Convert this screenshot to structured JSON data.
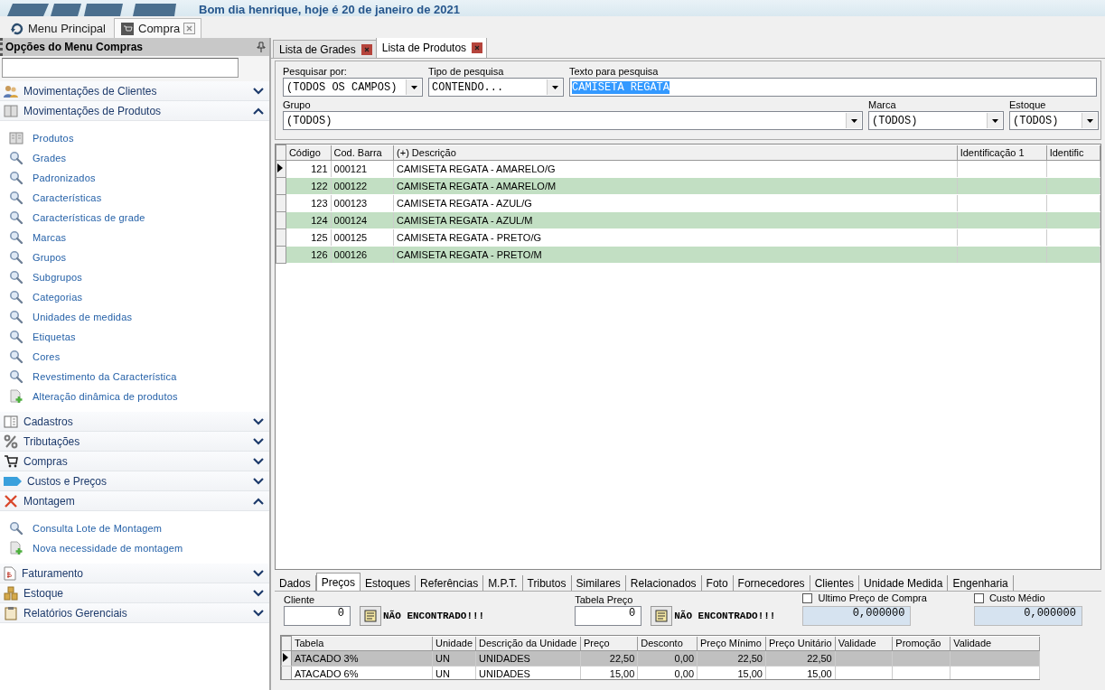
{
  "header": {
    "greeting": "Bom dia henrique, hoje é 20 de janeiro de 2021"
  },
  "main_tabs": [
    {
      "label": "Menu Principal",
      "selected": false,
      "closable": false
    },
    {
      "label": "Compra",
      "selected": true,
      "closable": true
    }
  ],
  "sidebar": {
    "title": "Opções do Menu Compras",
    "sections": [
      {
        "label": "Movimentações de Clientes",
        "expanded": false
      },
      {
        "label": "Movimentações de Produtos",
        "expanded": true,
        "children": [
          {
            "label": "Produtos",
            "kind": "book"
          },
          {
            "label": "Grades",
            "kind": "search"
          },
          {
            "label": "Padronizados",
            "kind": "search"
          },
          {
            "label": "Características",
            "kind": "search"
          },
          {
            "label": "Características de grade",
            "kind": "search"
          },
          {
            "label": "Marcas",
            "kind": "search"
          },
          {
            "label": "Grupos",
            "kind": "search"
          },
          {
            "label": "Subgrupos",
            "kind": "search"
          },
          {
            "label": "Categorias",
            "kind": "search"
          },
          {
            "label": "Unidades de medidas",
            "kind": "search"
          },
          {
            "label": "Etiquetas",
            "kind": "search"
          },
          {
            "label": "Cores",
            "kind": "search"
          },
          {
            "label": "Revestimento da Característica",
            "kind": "search"
          },
          {
            "label": "Alteração dinâmica de produtos",
            "kind": "add"
          }
        ]
      },
      {
        "label": "Cadastros",
        "expanded": false
      },
      {
        "label": "Tributações",
        "expanded": false
      },
      {
        "label": "Compras",
        "expanded": false
      },
      {
        "label": "Custos e Preços",
        "expanded": false
      },
      {
        "label": "Montagem",
        "expanded": true,
        "children": [
          {
            "label": "Consulta Lote de Montagem",
            "kind": "search"
          },
          {
            "label": "Nova necessidade de montagem",
            "kind": "add"
          }
        ]
      },
      {
        "label": "Faturamento",
        "expanded": false
      },
      {
        "label": "Estoque",
        "expanded": false
      },
      {
        "label": "Relatórios Gerenciais",
        "expanded": false
      }
    ]
  },
  "doc_tabs": [
    {
      "label": "Lista de Grades",
      "selected": false
    },
    {
      "label": "Lista de Produtos",
      "selected": true
    }
  ],
  "filters": {
    "search_by": {
      "label": "Pesquisar por:",
      "value": "(TODOS OS CAMPOS)"
    },
    "search_type": {
      "label": "Tipo de pesquisa",
      "value": "CONTENDO..."
    },
    "search_text": {
      "label": "Texto para pesquisa",
      "value": "CAMISETA REGATA"
    },
    "group": {
      "label": "Grupo",
      "value": "(TODOS)"
    },
    "brand": {
      "label": "Marca",
      "value": "(TODOS)"
    },
    "stock": {
      "label": "Estoque",
      "value": "(TODOS)"
    }
  },
  "table": {
    "columns": [
      "Código",
      "Cod. Barra",
      "(+) Descrição",
      "Identificação 1",
      "Identific"
    ],
    "rows": [
      {
        "selected": true,
        "cells": [
          "121",
          "000121",
          "CAMISETA REGATA - AMARELO/G"
        ]
      },
      {
        "selected": false,
        "cells": [
          "122",
          "000122",
          "CAMISETA REGATA - AMARELO/M"
        ]
      },
      {
        "selected": false,
        "cells": [
          "123",
          "000123",
          "CAMISETA REGATA - AZUL/G"
        ]
      },
      {
        "selected": false,
        "cells": [
          "124",
          "000124",
          "CAMISETA REGATA - AZUL/M"
        ]
      },
      {
        "selected": false,
        "cells": [
          "125",
          "000125",
          "CAMISETA REGATA - PRETO/G"
        ]
      },
      {
        "selected": false,
        "cells": [
          "126",
          "000126",
          "CAMISETA REGATA - PRETO/M"
        ]
      }
    ]
  },
  "detail_tabs": [
    {
      "label": "Dados",
      "selected": false
    },
    {
      "label": "Preços",
      "selected": true
    },
    {
      "label": "Estoques",
      "selected": false
    },
    {
      "label": "Referências",
      "selected": false
    },
    {
      "label": "M.P.T.",
      "selected": false
    },
    {
      "label": "Tributos",
      "selected": false
    },
    {
      "label": "Similares",
      "selected": false
    },
    {
      "label": "Relacionados",
      "selected": false
    },
    {
      "label": "Foto",
      "selected": false
    },
    {
      "label": "Fornecedores",
      "selected": false
    },
    {
      "label": "Clientes",
      "selected": false
    },
    {
      "label": "Unidade Medida",
      "selected": false
    },
    {
      "label": "Engenharia",
      "selected": false
    }
  ],
  "prices": {
    "client": {
      "label": "Cliente",
      "value": "0",
      "status": "NÃO ENCONTRADO!!!"
    },
    "price_table": {
      "label": "Tabela Preço",
      "value": "0",
      "status": "NÃO ENCONTRADO!!!"
    },
    "last_purchase": {
      "label": "Ultimo Preço de Compra",
      "checked": false,
      "value": "0,000000"
    },
    "avg_cost": {
      "label": "Custo Médio",
      "checked": false,
      "value": "0,000000"
    },
    "columns": [
      "Tabela",
      "Unidade",
      "Descrição da Unidade",
      "Preço",
      "Desconto",
      "Preço Mínimo",
      "Preço Unitário",
      "Validade",
      "Promoção",
      "Validade"
    ],
    "rows": [
      {
        "selected": true,
        "cells": [
          "ATACADO 3%",
          "UN",
          "UNIDADES",
          "22,50",
          "0,00",
          "22,50",
          "22,50",
          "",
          "",
          ""
        ]
      },
      {
        "selected": false,
        "cells": [
          "ATACADO 6%",
          "UN",
          "UNIDADES",
          "15,00",
          "0,00",
          "15,00",
          "15,00",
          "",
          "",
          ""
        ]
      }
    ]
  }
}
